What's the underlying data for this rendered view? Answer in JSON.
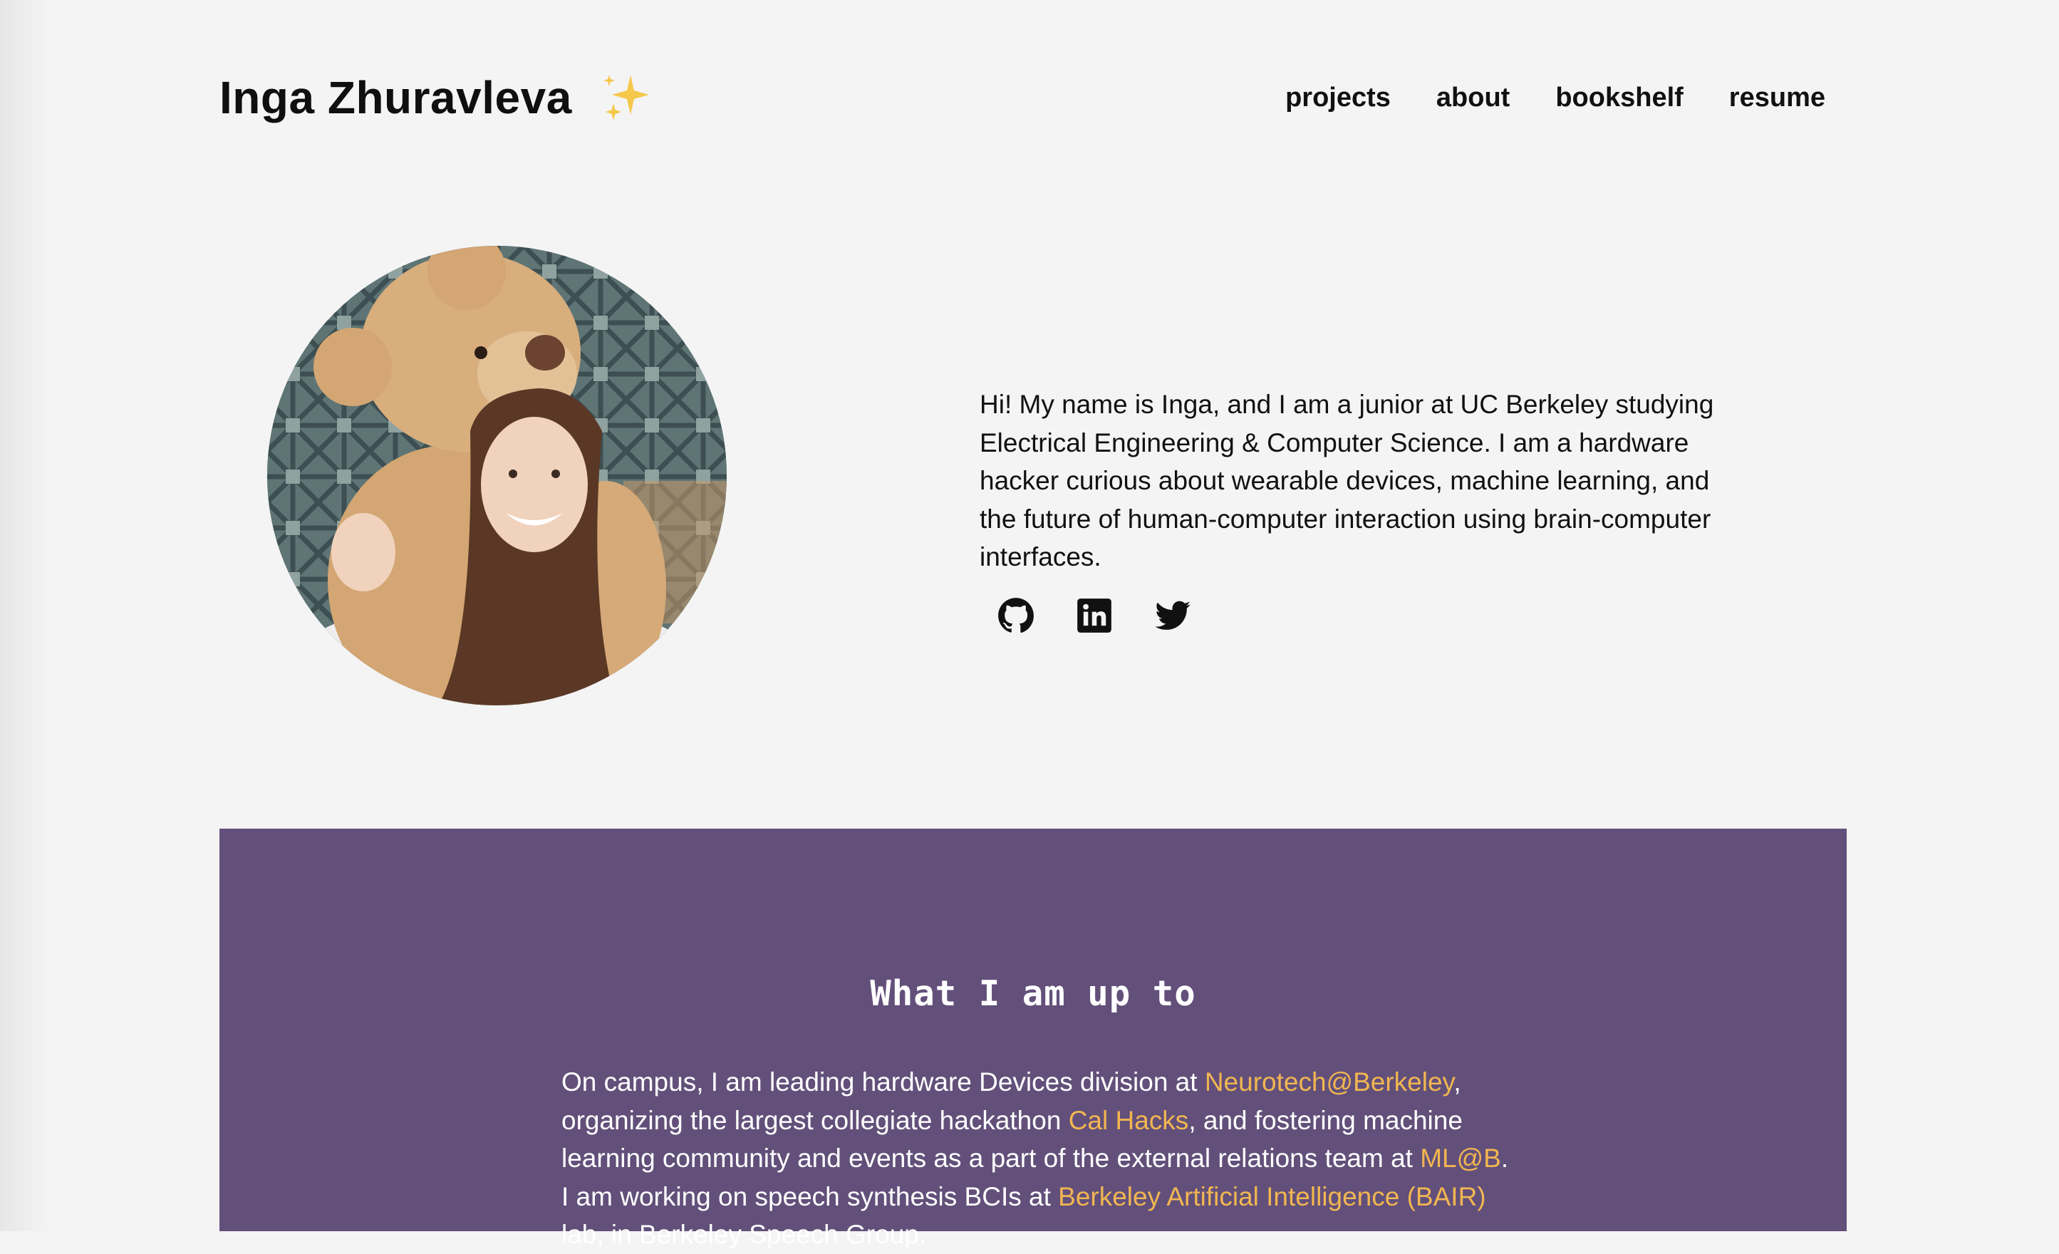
{
  "header": {
    "name": "Inga Zhuravleva",
    "sparkle": "sparkles-icon",
    "nav": [
      {
        "label": "projects"
      },
      {
        "label": "about"
      },
      {
        "label": "bookshelf"
      },
      {
        "label": "resume"
      }
    ]
  },
  "hero": {
    "intro": "Hi! My name is Inga, and I am a junior at UC Berkeley studying Electrical Engineering & Computer Science. I am a hardware hacker curious about wearable devices, machine learning, and the future of human-computer interaction using brain-computer interfaces.",
    "socials": [
      {
        "icon": "github-icon"
      },
      {
        "icon": "linkedin-icon"
      },
      {
        "icon": "twitter-icon"
      }
    ]
  },
  "section": {
    "title": "What I am up to",
    "p1": "On campus, I am leading hardware Devices division at ",
    "link1": "Neurotech@Berkeley",
    "p2": ", organizing the largest collegiate hackathon ",
    "link2": "Cal Hacks",
    "p3": ", and fostering machine learning community and events as a part of the external relations team at ",
    "link3": "ML@B",
    "p4": ". I am working on speech synthesis BCIs at ",
    "link4": "Berkeley Artificial Intelligence (BAIR)",
    "p5": " lab, in Berkeley Speech Group."
  },
  "colors": {
    "background": "#f4f4f4",
    "section_background": "#62507a",
    "link": "#f2b651",
    "text": "#111111"
  }
}
